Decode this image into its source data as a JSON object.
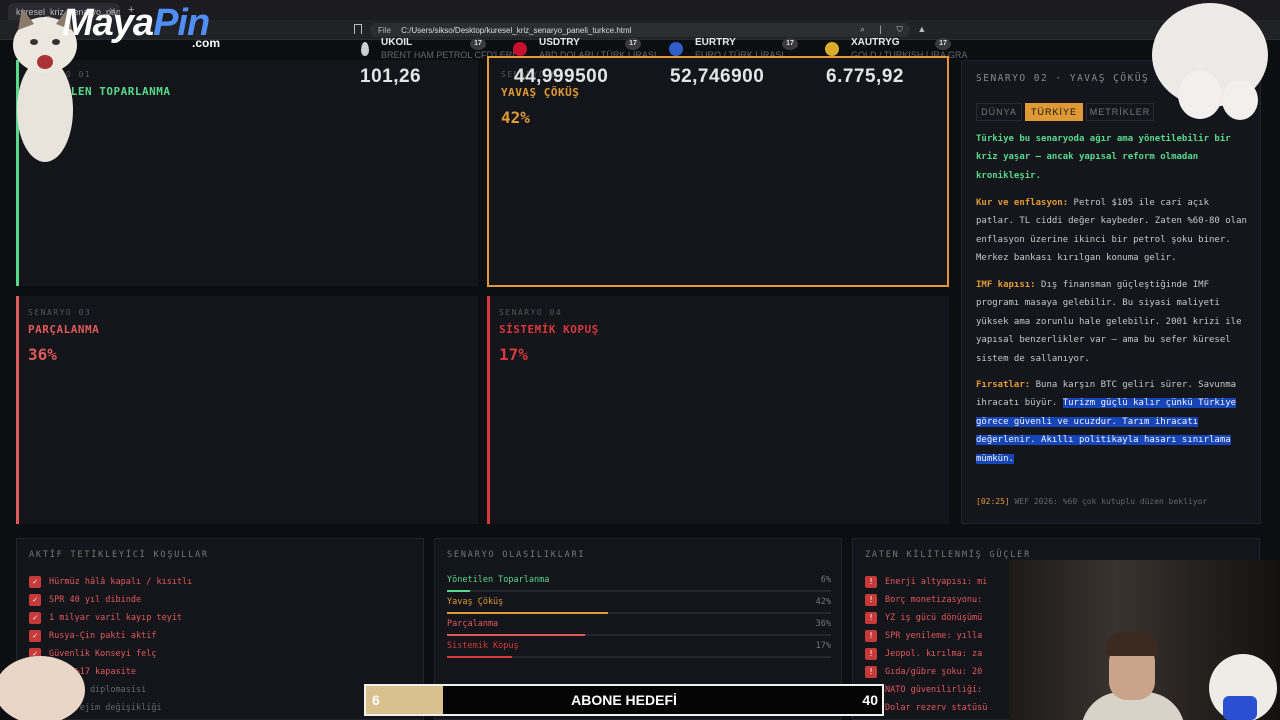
{
  "browser": {
    "tab_title": "kuresel_kriz_senaryo_paneli_tu",
    "tab_close": "✕",
    "new_tab": "+",
    "address_label": "File",
    "url": "C:/Users/sikso/Desktop/kuresel_kriz_senaryo_paneli_turkce.html"
  },
  "ticker": [
    {
      "symbol": "UKOIL",
      "subtitle": "BRENT HAM PETROL CFD'LERİ",
      "price": "101,26",
      "icon_color": "#cfcfcf"
    },
    {
      "symbol": "USDTRY",
      "subtitle": "ABD DOLARI / TÜRK LİRASI",
      "price": "44,999500",
      "icon_color": "#c8102e"
    },
    {
      "symbol": "EURTRY",
      "subtitle": "EURO / TÜRK LİRASI",
      "price": "52,746900",
      "icon_color": "#2e5fc9"
    },
    {
      "symbol": "XAUTRYG",
      "subtitle": "GOLD / TURKISH LIRA GRA",
      "price": "6.775,92",
      "icon_color": "#d9ac2a"
    }
  ],
  "tv_badge": "17",
  "scenarios": [
    {
      "num": "SENARYO 01",
      "name": "YÖNETİLEN TOPARLANMA",
      "pct": "",
      "color": "#57d98c"
    },
    {
      "num": "SENARYO 02",
      "name": "YAVAŞ ÇÖKÜŞ",
      "pct": "42%",
      "color": "#e09a35"
    },
    {
      "num": "SENARYO 03",
      "name": "PARÇALANMA",
      "pct": "36%",
      "color": "#e0595b"
    },
    {
      "num": "SENARYO 04",
      "name": "SİSTEMİK KOPUŞ",
      "pct": "17%",
      "color": "#d6383c"
    }
  ],
  "detail": {
    "title": "SENARYO 02 · YAVAŞ ÇÖKÜŞ",
    "tabs": [
      "DÜNYA",
      "TÜRKİYE",
      "METRİKLER"
    ],
    "active_tab": "TÜRKİYE",
    "intro": "Türkiye bu senaryoda ağır ama yönetilebilir bir kriz yaşar — ancak yapısal reform olmadan kronikleşir.",
    "p1_label": "Kur ve enflasyon:",
    "p1_text": "Petrol $105 ile cari açık patlar. TL ciddi değer kaybeder. Zaten %60-80 olan enflasyon üzerine ikinci bir petrol şoku biner. Merkez bankası kırılgan konuma gelir.",
    "p2_label": "IMF kapısı:",
    "p2_text": "Dış finansman güçleştiğinde IMF programı masaya gelebilir. Bu siyasi maliyeti yüksek ama zorunlu hale gelebilir. 2001 krizi ile yapısal benzerlikler var — ama bu sefer küresel sistem de sallanıyor.",
    "p3_label": "Fırsatlar:",
    "p3_text": "Buna karşın BTC geliri sürer. Savunma ihracatı büyür.",
    "p3_selected": "Turizm güçlü kalır çünkü Türkiye görece güvenli ve ucuzdur. Tarım ihracatı değerlenir. Akıllı politikayla hasarı sınırlama mümkün.",
    "footer_time": "[02:25]",
    "footer_text": "WEF 2026: %60 çok kutuplu düzen bekliyor"
  },
  "triggers": {
    "title": "AKTİF TETİKLEYİCİ KOŞULLAR",
    "check": "✓",
    "items": [
      "Hürmüz hâlâ kapalı / kısıtlı",
      "SPR 40 yıl dibinde",
      "1 milyar varil kayıp teyit",
      "Rusya-Çin pakti aktif",
      "Güvenlik Konseyi felç",
      "LNG -%17 kapasite",
      "Ateşkes diplomasisi",
      "İzan rejim değişikliği"
    ]
  },
  "probabilities": {
    "title": "SENARYO OLASILIKLARI",
    "items": [
      {
        "name": "Yönetilen Toparlanma",
        "value": "6%",
        "fraction": 0.06,
        "color": "#57d98c"
      },
      {
        "name": "Yavaş Çöküş",
        "value": "42%",
        "fraction": 0.42,
        "color": "#e09a35"
      },
      {
        "name": "Parçalanma",
        "value": "36%",
        "fraction": 0.36,
        "color": "#e0595b"
      },
      {
        "name": "Sistemik Kopuş",
        "value": "17%",
        "fraction": 0.17,
        "color": "#d6383c"
      }
    ]
  },
  "locked": {
    "title": "ZATEN KİLİTLENMİŞ GÜÇLER",
    "icon": "!",
    "items": [
      "Enerji altyapısı: mi",
      "Borç monetizasyonu:",
      "YZ iş gücü dönüşümü",
      "SPR yenileme: yılla",
      "Jeopol. kırılma: za",
      "Gıda/gübre şoku: 20",
      "NATO güvenilirliği:",
      "Dolar rezerv statüsü"
    ]
  },
  "overlay": {
    "logo_main": "Maya",
    "logo_accent": "Pin",
    "logo_suffix": ".com",
    "goal_current": "6",
    "goal_label": "ABONE HEDEFİ",
    "goal_target": "40",
    "goal_fraction": 0.15
  }
}
